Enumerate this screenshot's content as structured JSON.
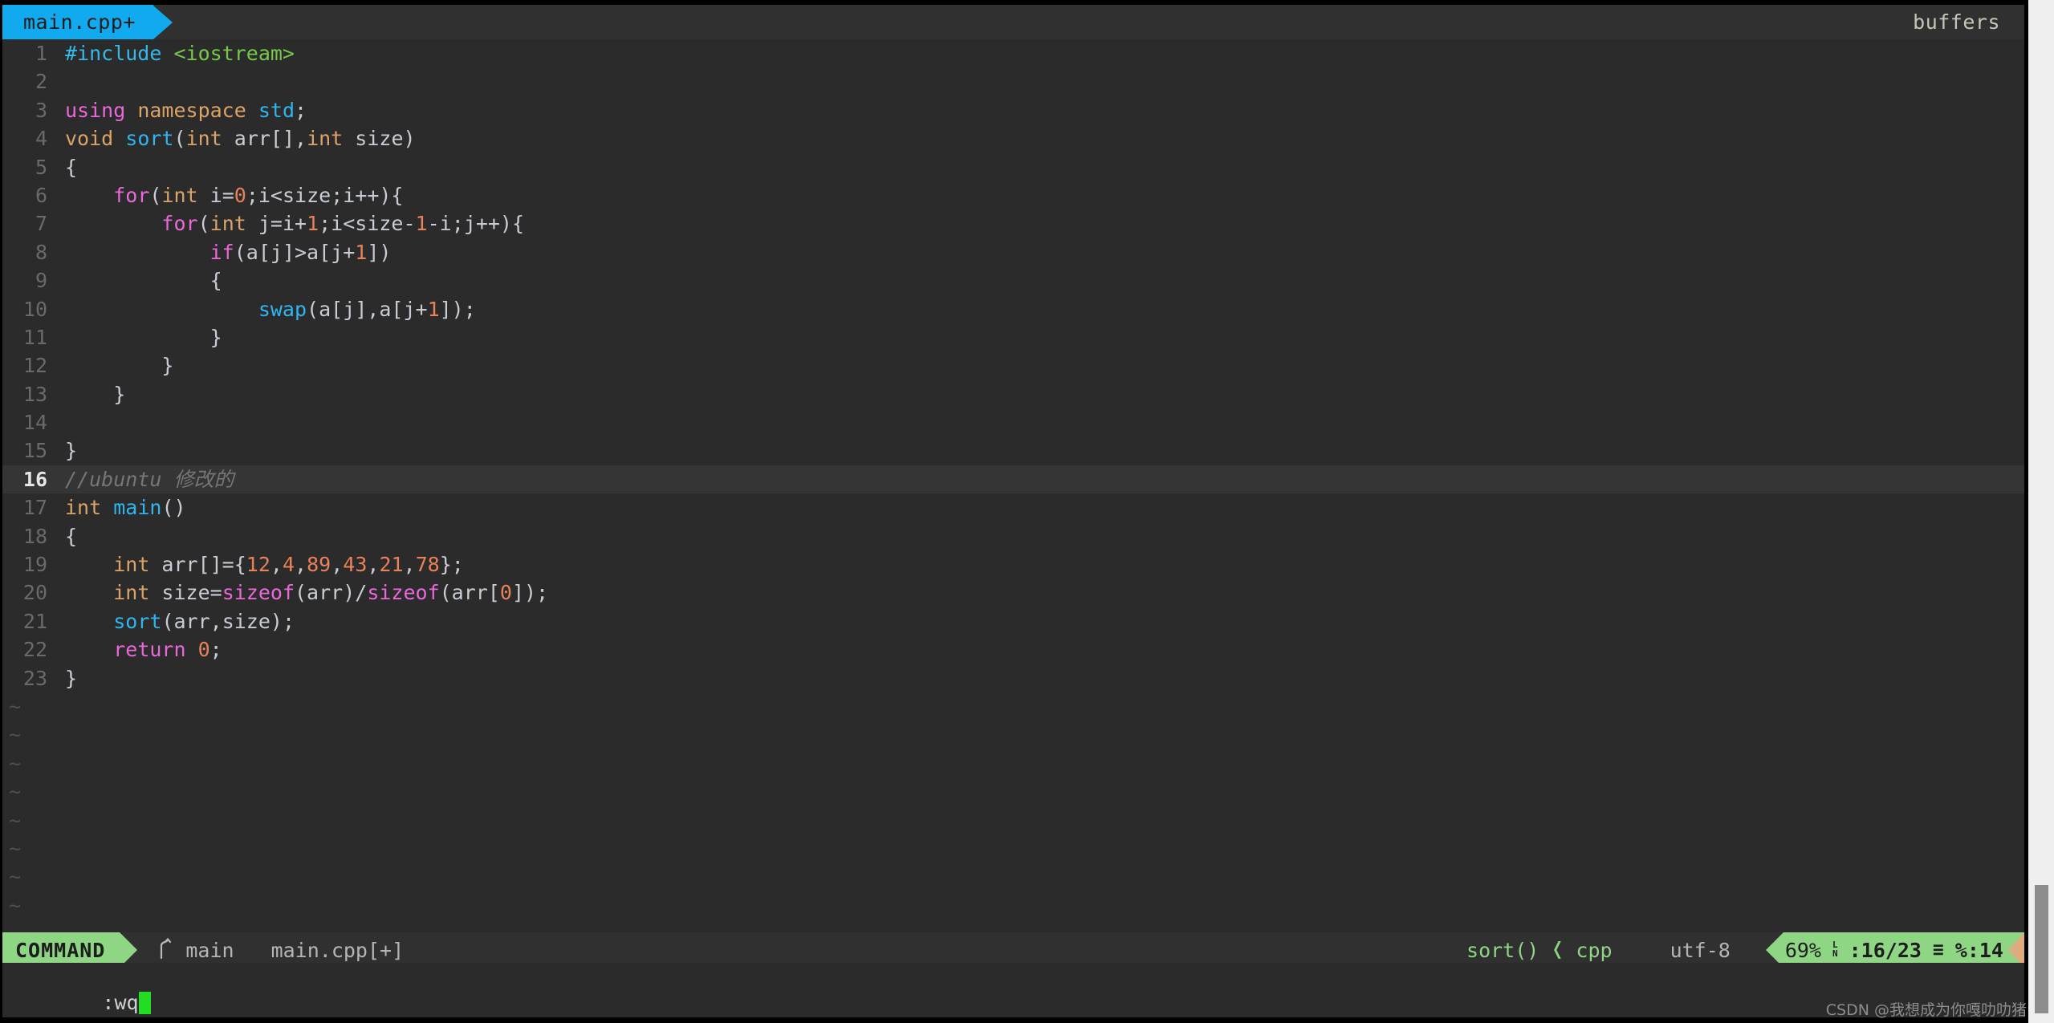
{
  "tabline": {
    "active_tab": "main.cpp+",
    "right_label": "buffers"
  },
  "editor": {
    "lines": [
      {
        "n": "1",
        "tokens": [
          {
            "t": "#include ",
            "c": "tk-pre"
          },
          {
            "t": "<iostream>",
            "c": "tk-str"
          }
        ]
      },
      {
        "n": "2",
        "tokens": [
          {
            "t": "",
            "c": "tk-id"
          }
        ]
      },
      {
        "n": "3",
        "tokens": [
          {
            "t": "using",
            "c": "tk-kw"
          },
          {
            "t": " ",
            "c": "tk-id"
          },
          {
            "t": "namespace",
            "c": "tk-type"
          },
          {
            "t": " ",
            "c": "tk-id"
          },
          {
            "t": "std",
            "c": "tk-fn"
          },
          {
            "t": ";",
            "c": "tk-id"
          }
        ]
      },
      {
        "n": "4",
        "tokens": [
          {
            "t": "void",
            "c": "tk-type"
          },
          {
            "t": " ",
            "c": "tk-id"
          },
          {
            "t": "sort",
            "c": "tk-fn"
          },
          {
            "t": "(",
            "c": "tk-id"
          },
          {
            "t": "int",
            "c": "tk-type"
          },
          {
            "t": " arr[],",
            "c": "tk-id"
          },
          {
            "t": "int",
            "c": "tk-type"
          },
          {
            "t": " size)",
            "c": "tk-id"
          }
        ]
      },
      {
        "n": "5",
        "tokens": [
          {
            "t": "{",
            "c": "tk-id"
          }
        ]
      },
      {
        "n": "6",
        "tokens": [
          {
            "t": "    ",
            "c": "tk-id"
          },
          {
            "t": "for",
            "c": "tk-kw"
          },
          {
            "t": "(",
            "c": "tk-id"
          },
          {
            "t": "int",
            "c": "tk-type"
          },
          {
            "t": " i=",
            "c": "tk-id"
          },
          {
            "t": "0",
            "c": "tk-num"
          },
          {
            "t": ";i<size;i++){",
            "c": "tk-id"
          }
        ]
      },
      {
        "n": "7",
        "tokens": [
          {
            "t": "        ",
            "c": "tk-id"
          },
          {
            "t": "for",
            "c": "tk-kw"
          },
          {
            "t": "(",
            "c": "tk-id"
          },
          {
            "t": "int",
            "c": "tk-type"
          },
          {
            "t": " j=i+",
            "c": "tk-id"
          },
          {
            "t": "1",
            "c": "tk-num"
          },
          {
            "t": ";i<size-",
            "c": "tk-id"
          },
          {
            "t": "1",
            "c": "tk-num"
          },
          {
            "t": "-i;j++){",
            "c": "tk-id"
          }
        ]
      },
      {
        "n": "8",
        "tokens": [
          {
            "t": "            ",
            "c": "tk-id"
          },
          {
            "t": "if",
            "c": "tk-kw"
          },
          {
            "t": "(a[j]>a[j+",
            "c": "tk-id"
          },
          {
            "t": "1",
            "c": "tk-num"
          },
          {
            "t": "])",
            "c": "tk-id"
          }
        ]
      },
      {
        "n": "9",
        "tokens": [
          {
            "t": "            {",
            "c": "tk-id"
          }
        ]
      },
      {
        "n": "10",
        "tokens": [
          {
            "t": "                ",
            "c": "tk-id"
          },
          {
            "t": "swap",
            "c": "tk-fn"
          },
          {
            "t": "(a[j],a[j+",
            "c": "tk-id"
          },
          {
            "t": "1",
            "c": "tk-num"
          },
          {
            "t": "]);",
            "c": "tk-id"
          }
        ]
      },
      {
        "n": "11",
        "tokens": [
          {
            "t": "            }",
            "c": "tk-id"
          }
        ]
      },
      {
        "n": "12",
        "tokens": [
          {
            "t": "        }",
            "c": "tk-id"
          }
        ]
      },
      {
        "n": "13",
        "tokens": [
          {
            "t": "    }",
            "c": "tk-id"
          }
        ]
      },
      {
        "n": "14",
        "tokens": [
          {
            "t": "",
            "c": "tk-id"
          }
        ]
      },
      {
        "n": "15",
        "tokens": [
          {
            "t": "}",
            "c": "tk-id"
          }
        ]
      },
      {
        "n": "16",
        "cursorline": true,
        "tokens": [
          {
            "t": "//ubuntu 修改的",
            "c": "tk-com"
          }
        ]
      },
      {
        "n": "17",
        "tokens": [
          {
            "t": "int",
            "c": "tk-type"
          },
          {
            "t": " ",
            "c": "tk-id"
          },
          {
            "t": "main",
            "c": "tk-fn"
          },
          {
            "t": "()",
            "c": "tk-id"
          }
        ]
      },
      {
        "n": "18",
        "tokens": [
          {
            "t": "{",
            "c": "tk-id"
          }
        ]
      },
      {
        "n": "19",
        "tokens": [
          {
            "t": "    ",
            "c": "tk-id"
          },
          {
            "t": "int",
            "c": "tk-type"
          },
          {
            "t": " arr[]={",
            "c": "tk-id"
          },
          {
            "t": "12",
            "c": "tk-num"
          },
          {
            "t": ",",
            "c": "tk-id"
          },
          {
            "t": "4",
            "c": "tk-num"
          },
          {
            "t": ",",
            "c": "tk-id"
          },
          {
            "t": "89",
            "c": "tk-num"
          },
          {
            "t": ",",
            "c": "tk-id"
          },
          {
            "t": "43",
            "c": "tk-num"
          },
          {
            "t": ",",
            "c": "tk-id"
          },
          {
            "t": "21",
            "c": "tk-num"
          },
          {
            "t": ",",
            "c": "tk-id"
          },
          {
            "t": "78",
            "c": "tk-num"
          },
          {
            "t": "};",
            "c": "tk-id"
          }
        ]
      },
      {
        "n": "20",
        "tokens": [
          {
            "t": "    ",
            "c": "tk-id"
          },
          {
            "t": "int",
            "c": "tk-type"
          },
          {
            "t": " size=",
            "c": "tk-id"
          },
          {
            "t": "sizeof",
            "c": "tk-kw"
          },
          {
            "t": "(arr)/",
            "c": "tk-id"
          },
          {
            "t": "sizeof",
            "c": "tk-kw"
          },
          {
            "t": "(arr[",
            "c": "tk-id"
          },
          {
            "t": "0",
            "c": "tk-num"
          },
          {
            "t": "]);",
            "c": "tk-id"
          }
        ]
      },
      {
        "n": "21",
        "tokens": [
          {
            "t": "    ",
            "c": "tk-id"
          },
          {
            "t": "sort",
            "c": "tk-fn"
          },
          {
            "t": "(arr,size);",
            "c": "tk-id"
          }
        ]
      },
      {
        "n": "22",
        "tokens": [
          {
            "t": "    ",
            "c": "tk-id"
          },
          {
            "t": "return",
            "c": "tk-kw"
          },
          {
            "t": " ",
            "c": "tk-id"
          },
          {
            "t": "0",
            "c": "tk-num"
          },
          {
            "t": ";",
            "c": "tk-id"
          }
        ]
      },
      {
        "n": "23",
        "tokens": [
          {
            "t": "}",
            "c": "tk-id"
          }
        ]
      }
    ],
    "empty_marker": "~",
    "empty_marker_count": 9
  },
  "statusline": {
    "mode": "COMMAND",
    "branch_icon": "git-branch-icon",
    "branch": "main",
    "file": "main.cpp[+]",
    "context_function": "sort()",
    "separator_glyph": "❬",
    "language": "cpp",
    "encoding": "utf-8",
    "percent": "69%",
    "line_glyph_top": "L",
    "line_glyph_bottom": "N",
    "line_position": ":16/23",
    "column_glyph": "≡",
    "column_position": "%:14"
  },
  "cmdline": {
    "text": ":wq"
  },
  "watermark": {
    "text": "CSDN @我想成为你嘎叻叻猪"
  },
  "colors": {
    "tab_active_bg": "#11AAEE",
    "mode_bg": "#8ed684",
    "editor_bg": "#2b2b2b",
    "statusline_bg": "#303030",
    "cursor": "#22dd22",
    "position_tail": "#dcab7e"
  }
}
